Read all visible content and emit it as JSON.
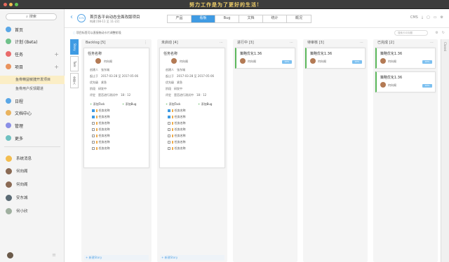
{
  "window": {
    "slogan": "努力工作是为了更好的生活!",
    "dots": [
      "#e96b5e",
      "#f3bd4f",
      "#61c454"
    ]
  },
  "sidebar": {
    "search_label": "搜索",
    "nav": [
      {
        "label": "首页",
        "color": "#5aa7e6",
        "has_plus": false
      },
      {
        "label": "计划 (Beta)",
        "color": "#6fc18a",
        "has_plus": false
      },
      {
        "label": "任务",
        "color": "#e96b6b",
        "has_plus": true
      },
      {
        "label": "项目",
        "color": "#e9935e",
        "has_plus": true
      }
    ],
    "projects": [
      "鱼骨精益敏捷开发项目",
      "鱼骨用户反馈跟进"
    ],
    "nav2": [
      {
        "label": "日程",
        "color": "#5aa7e6"
      },
      {
        "label": "文档中心",
        "color": "#e9b35e"
      },
      {
        "label": "管理",
        "color": "#8a8fe6"
      },
      {
        "label": "更多",
        "color": "#6fc1c1"
      }
    ],
    "messages": [
      {
        "label": "系统消息",
        "color": "#f3bd4f"
      },
      {
        "label": "何向阁",
        "color": "#8a6a54"
      },
      {
        "label": "何向阁",
        "color": "#8a6a54"
      },
      {
        "label": "安东城",
        "color": "#5a6a74"
      },
      {
        "label": "何小欣",
        "color": "#a0b0a0"
      }
    ]
  },
  "header": {
    "progress": "52%",
    "project_title": "首页各平台动态全面改版项目",
    "date": "构建 [08-11 至 11-22]",
    "tabs": [
      "产品",
      "看板",
      "Bug",
      "文档",
      "统计",
      "概况"
    ],
    "active_tab": 1,
    "right_icons": [
      "CMS",
      "dl",
      "doc",
      "folder",
      "gear"
    ],
    "notice": "项目标签可以直接拖动卡片调整阶段",
    "filter_placeholder": "搜索卡片标题"
  },
  "vtabs": [
    "Story",
    "Task",
    "全部人"
  ],
  "columns": [
    {
      "title": "Backlog [5]"
    },
    {
      "title": "未启动 [4]"
    },
    {
      "title": "进行中 [3]"
    },
    {
      "title": "待审核 [3]"
    },
    {
      "title": "已完成 [2]"
    }
  ],
  "detail_card": {
    "name": "任务名称",
    "user": "何向阁",
    "creator_label": "创建人",
    "creator": "张东城",
    "dates_label": "起止于",
    "dates": "2017-03-28 至 2017-05-06",
    "priority_label": "优先级",
    "priority": "紧急",
    "stage_label": "阶段",
    "stage": "研发中",
    "review_label": "评定",
    "review": "是否进行测试中",
    "time": "18：12",
    "add_task": "添加Task",
    "add_bug": "添加Bug",
    "tasks": [
      {
        "label": "任务名称",
        "checked": true
      },
      {
        "label": "任务名称",
        "checked": true
      },
      {
        "label": "任务名称",
        "checked": false
      },
      {
        "label": "任务名称",
        "checked": false
      },
      {
        "label": "任务名称",
        "checked": false
      },
      {
        "label": "任务名称",
        "checked": false
      },
      {
        "label": "任务名称",
        "checked": false
      }
    ],
    "new_story": "+ 新建Story"
  },
  "small_card": {
    "name": "策略优化1.36",
    "user": "何向阁",
    "tag": "90%"
  },
  "closed_label": "Closed"
}
